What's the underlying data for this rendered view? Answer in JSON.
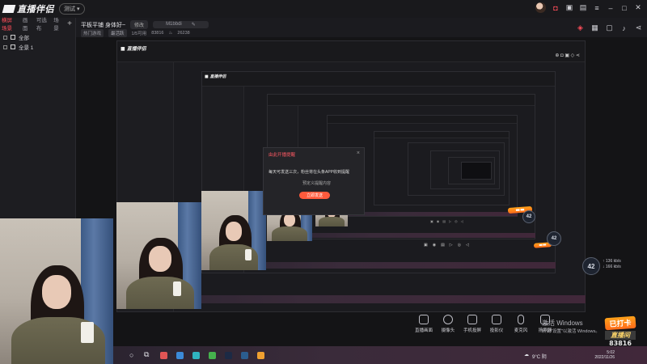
{
  "app": {
    "logo_text": "直播伴侣",
    "beta_label": "测试"
  },
  "left_panel": {
    "tabs": [
      "横屏场景",
      "画面",
      "可选布",
      "场景"
    ],
    "add": "+",
    "items": [
      {
        "label": "全部"
      },
      {
        "label": "全景 1"
      }
    ]
  },
  "infobar": {
    "title": "平板平铺 身体好~",
    "edit_label": "修改",
    "id_label": "ID",
    "id_value": "M1bbdi",
    "tags": [
      "热门游戏",
      "最活跃",
      "1/5可用",
      "83816",
      "26238"
    ]
  },
  "dialog": {
    "title": "由此开播提醒",
    "message": "每天可发送三次，粉丝将在头条APP收到提醒",
    "sub": "预定义提醒内容",
    "button": "立即发送"
  },
  "bottom_tools": [
    {
      "label": "直播画面",
      "icon": "screen-icon"
    },
    {
      "label": "摄像头",
      "icon": "camera-icon"
    },
    {
      "label": "手机投屏",
      "icon": "phone-cast-icon"
    },
    {
      "label": "投影仪",
      "icon": "projector-icon"
    },
    {
      "label": "麦克风",
      "icon": "microphone-icon"
    },
    {
      "label": "扬声器",
      "icon": "speaker-icon"
    }
  ],
  "overlay": {
    "count": "42",
    "speed_up": "136",
    "speed_down": "166",
    "speed_unit": "kb/s",
    "sticker_top": "已打卡",
    "sticker_mid": "直播间",
    "sticker_num": "83816"
  },
  "watermark": {
    "line1": "激活 Windows",
    "line2": "转到\"设置\"以激活 Windows。"
  },
  "system": {
    "weather": "9°C 阴",
    "time": "5:02",
    "date": "2022/11/26"
  },
  "colors": {
    "accent": "#ff4d5a",
    "button": "#ff5a3c",
    "background": "#1b1b1f"
  }
}
